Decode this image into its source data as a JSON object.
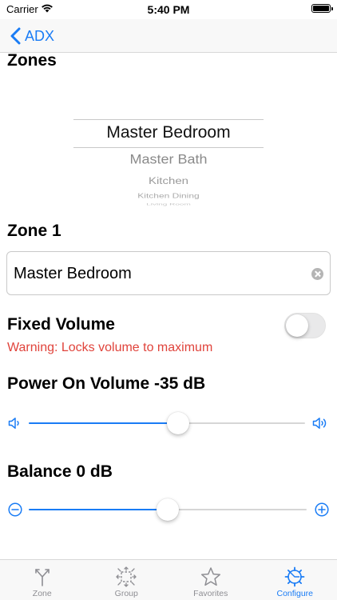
{
  "status_bar": {
    "carrier": "Carrier",
    "time": "5:40 PM"
  },
  "nav": {
    "back_label": "ADX"
  },
  "zones": {
    "title": "Zones",
    "picker_items": [
      "Master Bedroom",
      "Master Bath",
      "Kitchen",
      "Kitchen Dining",
      "Living Room"
    ],
    "selected": "Master Bedroom"
  },
  "zone": {
    "title": "Zone 1",
    "name_value": "Master Bedroom"
  },
  "fixed_volume": {
    "title": "Fixed Volume",
    "enabled": false,
    "warning": "Warning: Locks volume to maximum"
  },
  "power_on_volume": {
    "title": "Power On Volume -35 dB",
    "level": 0.54
  },
  "balance": {
    "title": "Balance 0 dB",
    "level": 0.5
  },
  "tabs": [
    {
      "label": "Zone",
      "icon": "zone-icon",
      "active": false
    },
    {
      "label": "Group",
      "icon": "group-icon",
      "active": false
    },
    {
      "label": "Favorites",
      "icon": "star-icon",
      "active": false
    },
    {
      "label": "Configure",
      "icon": "configure-gear-icon",
      "active": true
    }
  ],
  "colors": {
    "accent": "#1a7cf5",
    "warning": "#e0433b",
    "inactive": "#8e8e93"
  }
}
